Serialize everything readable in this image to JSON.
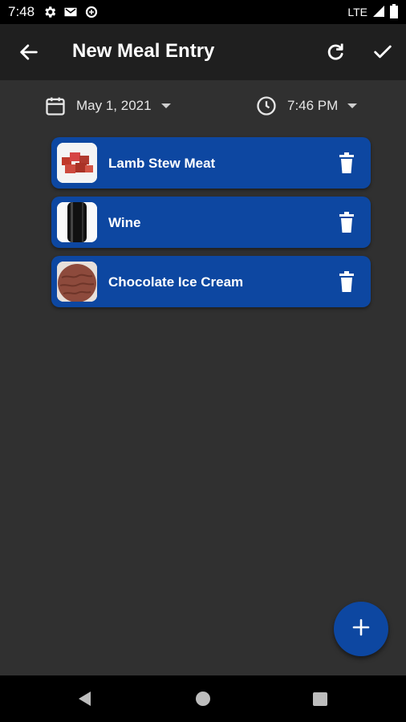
{
  "status_bar": {
    "time": "7:48",
    "network": "LTE"
  },
  "app_bar": {
    "title": "New Meal Entry"
  },
  "pickers": {
    "date": "May 1, 2021",
    "time": "7:46 PM"
  },
  "meal_items": [
    {
      "name": "Lamb Stew Meat",
      "icon": "lamb-stew-meat-thumbnail"
    },
    {
      "name": "Wine",
      "icon": "wine-bottle-thumbnail"
    },
    {
      "name": "Chocolate Ice Cream",
      "icon": "chocolate-ice-cream-thumbnail"
    }
  ],
  "colors": {
    "accent": "#0d47a1",
    "background": "#303030",
    "app_bar": "#1f1f1f"
  }
}
